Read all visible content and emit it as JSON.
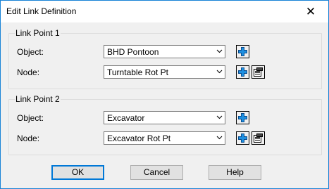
{
  "window": {
    "title": "Edit Link Definition",
    "close_glyph": "✕"
  },
  "groups": [
    {
      "title": "Link Point 1",
      "object_label": "Object:",
      "object_value": "BHD Pontoon",
      "node_label": "Node:",
      "node_value": "Turntable Rot Pt"
    },
    {
      "title": "Link Point 2",
      "object_label": "Object:",
      "object_value": "Excavator",
      "node_label": "Node:",
      "node_value": "Excavator Rot Pt"
    }
  ],
  "buttons": {
    "ok": "OK",
    "cancel": "Cancel",
    "help": "Help"
  },
  "icons": {
    "add": "plus-icon",
    "edit": "edit-properties-icon"
  },
  "colors": {
    "accent": "#0078d7",
    "window_border": "#1883d7",
    "plus": "#1e8fe0"
  }
}
